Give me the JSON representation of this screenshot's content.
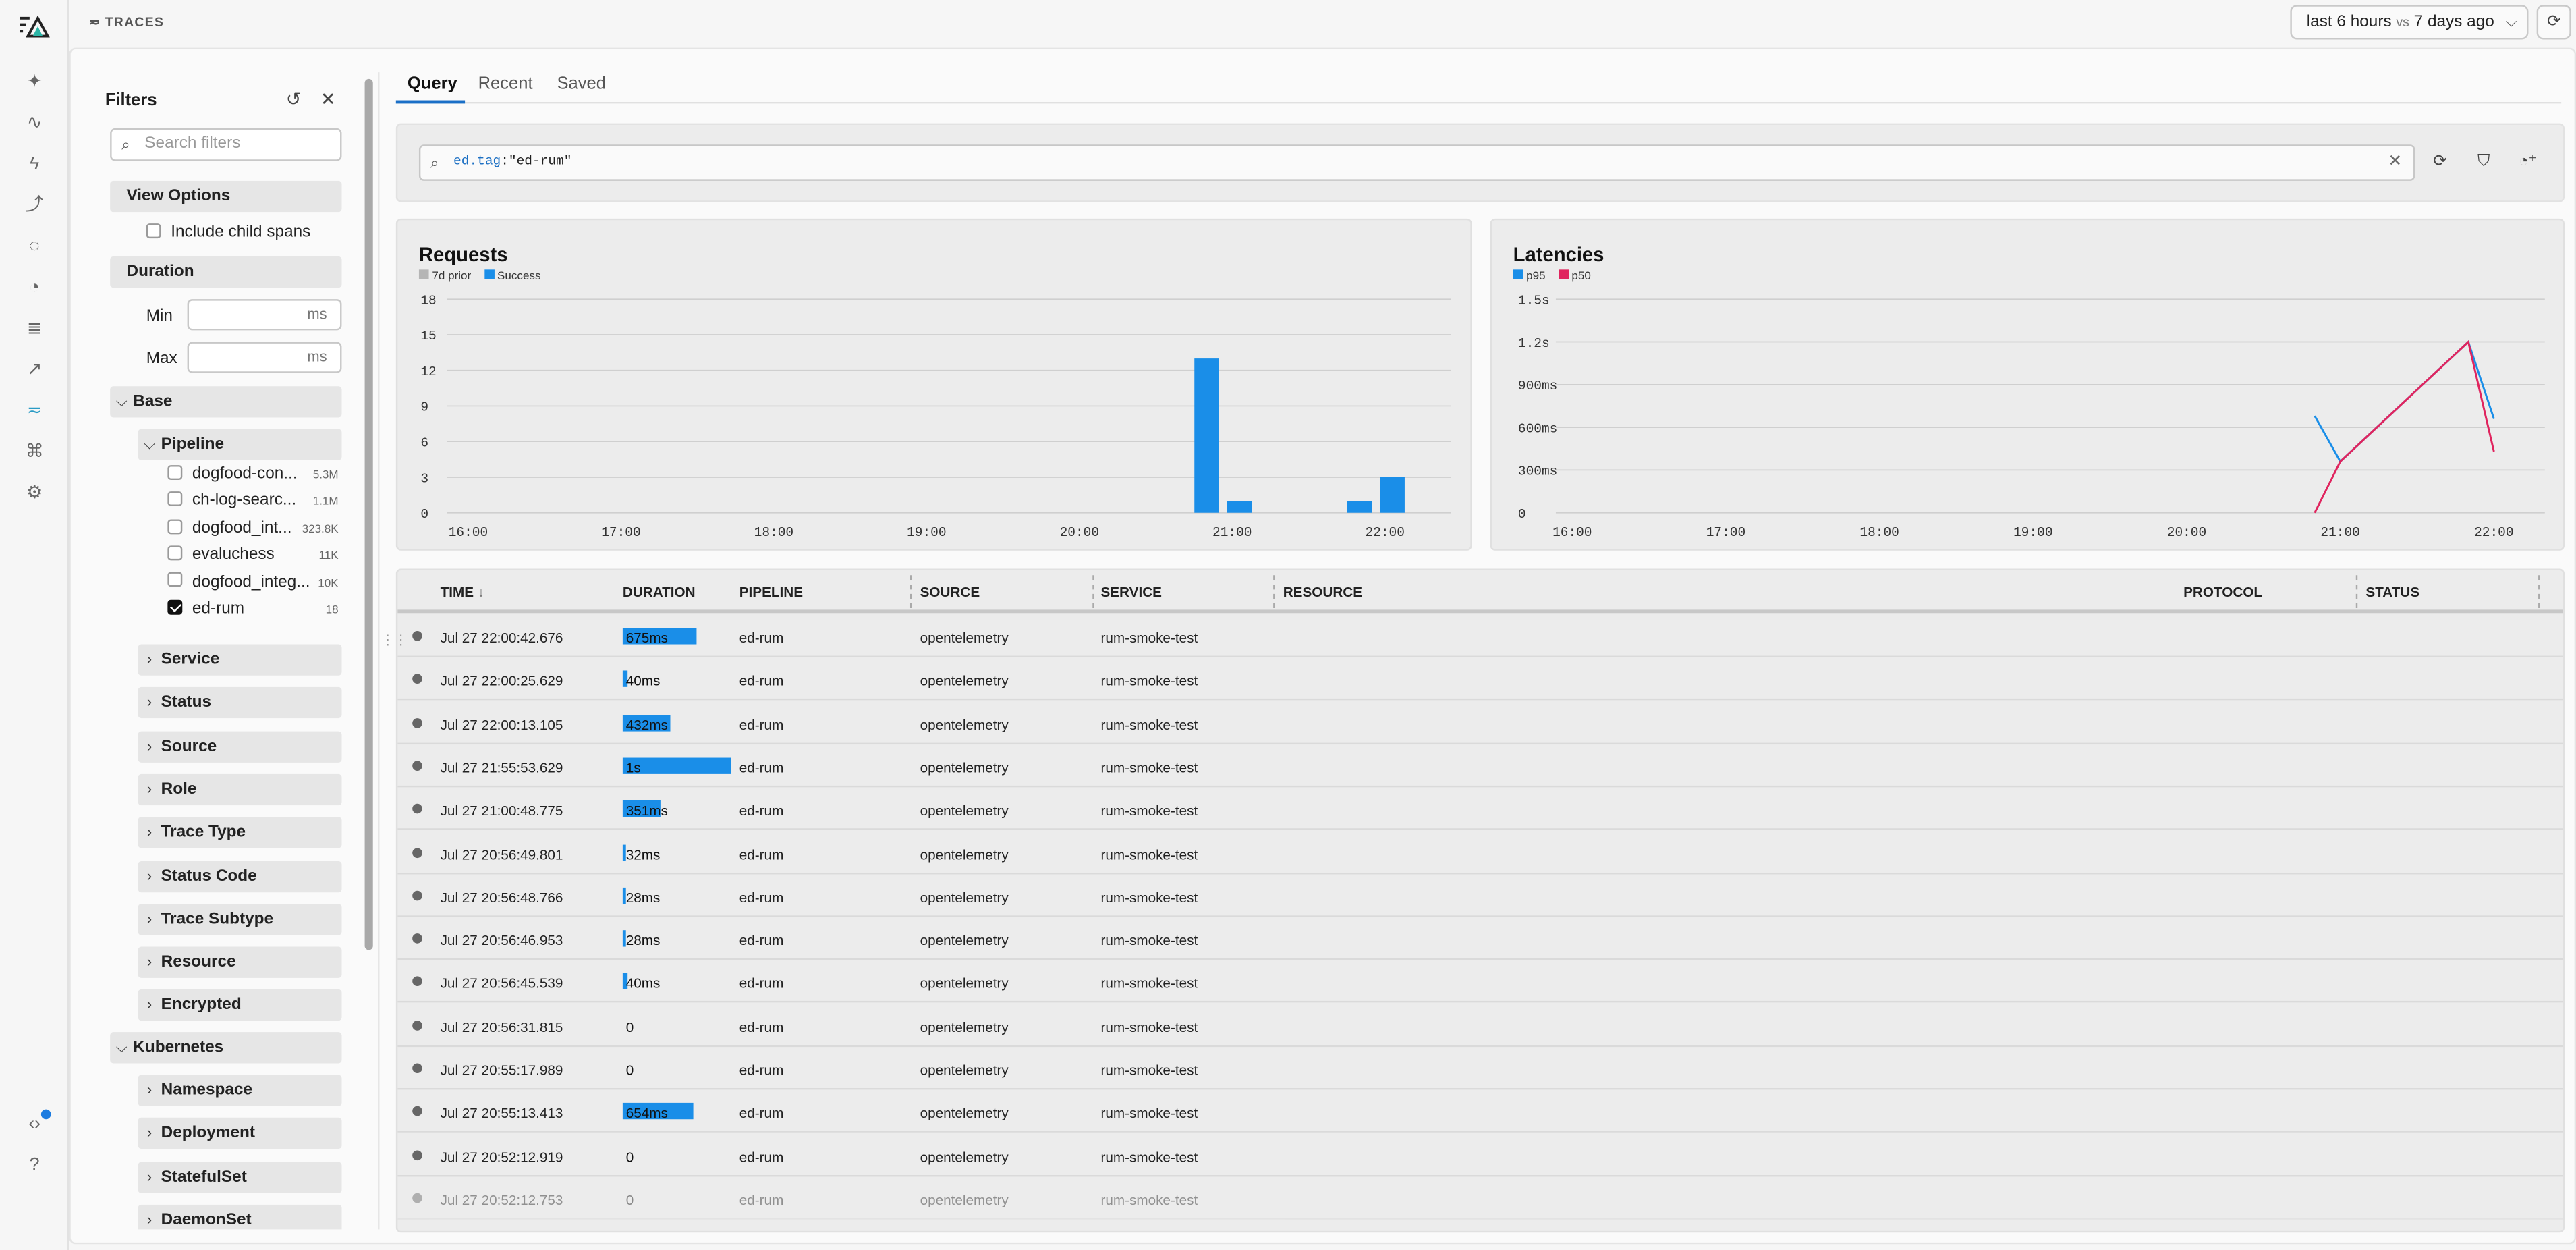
{
  "topbar": {
    "crumb": "TRACES",
    "time_range": "last 6 hours",
    "vs_label": "vs",
    "compare": "7 days ago"
  },
  "filters": {
    "title": "Filters",
    "search_placeholder": "Search filters",
    "view_options": "View Options",
    "include_child_spans": "Include child spans",
    "duration": "Duration",
    "min_label": "Min",
    "max_label": "Max",
    "ms_unit": "ms",
    "base": "Base",
    "pipeline": "Pipeline",
    "pipelines": [
      {
        "name": "dogfood-con...",
        "count": "5.3M",
        "checked": false
      },
      {
        "name": "ch-log-searc...",
        "count": "1.1M",
        "checked": false
      },
      {
        "name": "dogfood_int...",
        "count": "323.8K",
        "checked": false
      },
      {
        "name": "evaluchess",
        "count": "11K",
        "checked": false
      },
      {
        "name": "dogfood_integ...",
        "count": "10K",
        "checked": false
      },
      {
        "name": "ed-rum",
        "count": "18",
        "checked": true
      }
    ],
    "base_groups": [
      "Service",
      "Status",
      "Source",
      "Role",
      "Trace Type",
      "Status Code",
      "Trace Subtype",
      "Resource",
      "Encrypted"
    ],
    "kubernetes": "Kubernetes",
    "k8s_groups": [
      "Namespace",
      "Deployment",
      "StatefulSet",
      "DaemonSet"
    ]
  },
  "tabs": [
    "Query",
    "Recent",
    "Saved"
  ],
  "query": {
    "key": "ed.tag",
    "value": ":\"ed-rum\""
  },
  "requests_chart": {
    "title": "Requests",
    "legend": [
      {
        "name": "7d prior",
        "color": "#b5b5b5"
      },
      {
        "name": "Success",
        "color": "#1a8ee8"
      }
    ]
  },
  "latency_chart": {
    "title": "Latencies",
    "legend": [
      {
        "name": "p95",
        "color": "#1a8ee8"
      },
      {
        "name": "p50",
        "color": "#e0245e"
      }
    ]
  },
  "chart_data": [
    {
      "type": "bar",
      "title": "Requests",
      "y_ticks": [
        "0",
        "3",
        "6",
        "9",
        "12",
        "15",
        "18"
      ],
      "ylim": [
        0,
        18
      ],
      "x_ticks": [
        "16:00",
        "17:00",
        "18:00",
        "19:00",
        "20:00",
        "21:00",
        "22:00"
      ],
      "series": [
        {
          "name": "Success",
          "points": [
            {
              "x": "20:50",
              "y": 13
            },
            {
              "x": "21:00",
              "y": 1
            },
            {
              "x": "21:50",
              "y": 1
            },
            {
              "x": "22:00",
              "y": 3
            }
          ]
        }
      ]
    },
    {
      "type": "line",
      "title": "Latencies",
      "y_ticks": [
        "0",
        "300ms",
        "600ms",
        "900ms",
        "1.2s",
        "1.5s"
      ],
      "ylim": [
        0,
        1.5
      ],
      "x_ticks": [
        "16:00",
        "17:00",
        "18:00",
        "19:00",
        "20:00",
        "21:00",
        "22:00"
      ],
      "series": [
        {
          "name": "p95",
          "points": [
            {
              "x": "20:50",
              "y": 0.68
            },
            {
              "x": "21:00",
              "y": 0.36
            },
            {
              "x": "21:50",
              "y": 1.2
            },
            {
              "x": "22:00",
              "y": 0.66
            }
          ]
        },
        {
          "name": "p50",
          "points": [
            {
              "x": "20:50",
              "y": 0
            },
            {
              "x": "21:00",
              "y": 0.36
            },
            {
              "x": "21:50",
              "y": 1.2
            },
            {
              "x": "22:00",
              "y": 0.43
            }
          ]
        }
      ]
    }
  ],
  "table": {
    "columns": [
      "TIME",
      "DURATION",
      "PIPELINE",
      "SOURCE",
      "SERVICE",
      "RESOURCE",
      "PROTOCOL",
      "STATUS"
    ],
    "max_duration_ms": 1000,
    "rows": [
      {
        "time": "Jul 27 22:00:42.676",
        "duration": "675ms",
        "ms": 675,
        "pipeline": "ed-rum",
        "source": "opentelemetry",
        "service": "rum-smoke-test"
      },
      {
        "time": "Jul 27 22:00:25.629",
        "duration": "40ms",
        "ms": 40,
        "pipeline": "ed-rum",
        "source": "opentelemetry",
        "service": "rum-smoke-test"
      },
      {
        "time": "Jul 27 22:00:13.105",
        "duration": "432ms",
        "ms": 432,
        "pipeline": "ed-rum",
        "source": "opentelemetry",
        "service": "rum-smoke-test"
      },
      {
        "time": "Jul 27 21:55:53.629",
        "duration": "1s",
        "ms": 1000,
        "pipeline": "ed-rum",
        "source": "opentelemetry",
        "service": "rum-smoke-test"
      },
      {
        "time": "Jul 27 21:00:48.775",
        "duration": "351ms",
        "ms": 351,
        "pipeline": "ed-rum",
        "source": "opentelemetry",
        "service": "rum-smoke-test"
      },
      {
        "time": "Jul 27 20:56:49.801",
        "duration": "32ms",
        "ms": 32,
        "pipeline": "ed-rum",
        "source": "opentelemetry",
        "service": "rum-smoke-test"
      },
      {
        "time": "Jul 27 20:56:48.766",
        "duration": "28ms",
        "ms": 28,
        "pipeline": "ed-rum",
        "source": "opentelemetry",
        "service": "rum-smoke-test"
      },
      {
        "time": "Jul 27 20:56:46.953",
        "duration": "28ms",
        "ms": 28,
        "pipeline": "ed-rum",
        "source": "opentelemetry",
        "service": "rum-smoke-test"
      },
      {
        "time": "Jul 27 20:56:45.539",
        "duration": "40ms",
        "ms": 40,
        "pipeline": "ed-rum",
        "source": "opentelemetry",
        "service": "rum-smoke-test"
      },
      {
        "time": "Jul 27 20:56:31.815",
        "duration": "0",
        "ms": 0,
        "pipeline": "ed-rum",
        "source": "opentelemetry",
        "service": "rum-smoke-test"
      },
      {
        "time": "Jul 27 20:55:17.989",
        "duration": "0",
        "ms": 0,
        "pipeline": "ed-rum",
        "source": "opentelemetry",
        "service": "rum-smoke-test"
      },
      {
        "time": "Jul 27 20:55:13.413",
        "duration": "654ms",
        "ms": 654,
        "pipeline": "ed-rum",
        "source": "opentelemetry",
        "service": "rum-smoke-test"
      },
      {
        "time": "Jul 27 20:52:12.919",
        "duration": "0",
        "ms": 0,
        "pipeline": "ed-rum",
        "source": "opentelemetry",
        "service": "rum-smoke-test"
      },
      {
        "time": "Jul 27 20:52:12.753",
        "duration": "0",
        "ms": 0,
        "pipeline": "ed-rum",
        "source": "opentelemetry",
        "service": "rum-smoke-test"
      }
    ]
  }
}
